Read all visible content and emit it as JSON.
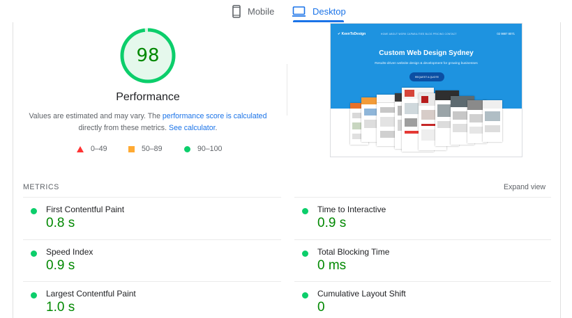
{
  "tabs": {
    "mobile": "Mobile",
    "desktop": "Desktop"
  },
  "performance": {
    "score": "98",
    "score_fraction": 0.98,
    "title": "Performance",
    "desc_prefix": "Values are estimated and may vary. The ",
    "desc_link1": "performance score is calculated",
    "desc_middle": " directly from these metrics. ",
    "desc_link2": "See calculator",
    "desc_suffix": "."
  },
  "legend": [
    {
      "range": "0–49",
      "color": "#ff3333"
    },
    {
      "range": "50–89",
      "color": "#ffaa33"
    },
    {
      "range": "90–100",
      "color": "#0cce6b"
    }
  ],
  "screenshot": {
    "logo": "KeenToDesign",
    "menu": "HOME   ABOUT   WORK   CAPABILITIES   BLOG   PRICING   CONTACT",
    "phone": "02 9887 8071",
    "headline": "Custom Web Design Sydney",
    "subheadline": "Results-driven website design & development for growing businesses",
    "button": "REQUEST A QUOTE",
    "hero_color": "#1e93e0"
  },
  "metrics": {
    "title": "METRICS",
    "expand": "Expand view",
    "items": [
      {
        "label": "First Contentful Paint",
        "value": "0.8 s"
      },
      {
        "label": "Time to Interactive",
        "value": "0.9 s"
      },
      {
        "label": "Speed Index",
        "value": "0.9 s"
      },
      {
        "label": "Total Blocking Time",
        "value": "0 ms"
      },
      {
        "label": "Largest Contentful Paint",
        "value": "1.0 s"
      },
      {
        "label": "Cumulative Layout Shift",
        "value": "0"
      }
    ]
  },
  "colors": {
    "accent": "#1a73e8",
    "pass": "#0cce6b",
    "pass_text": "#008800"
  }
}
